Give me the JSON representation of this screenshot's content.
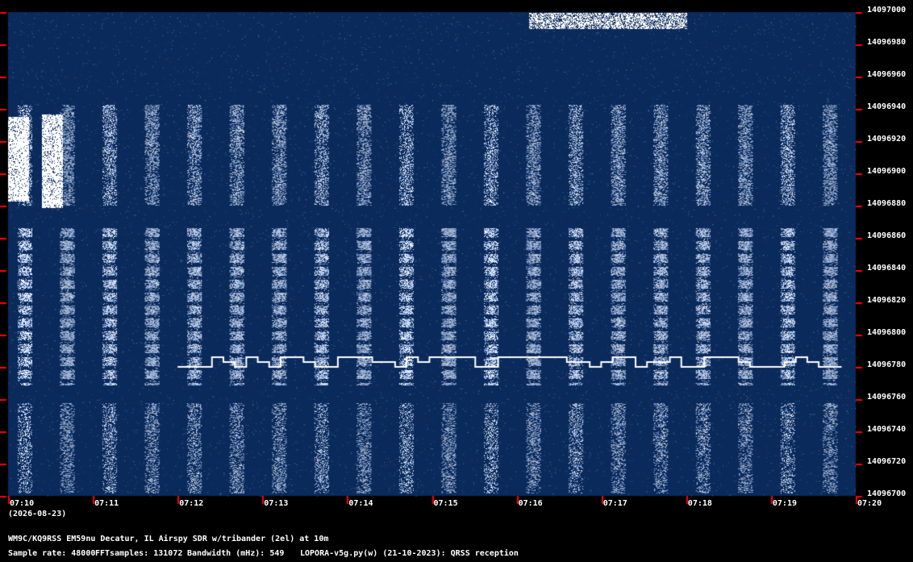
{
  "chart_data": {
    "type": "heatmap",
    "subtype": "spectrogram-waterfall",
    "y_ticks": [
      "14097000",
      "14096980",
      "14096960",
      "14096940",
      "14096920",
      "14096900",
      "14096880",
      "14096860",
      "14096840",
      "14096820",
      "14096800",
      "14096780",
      "14096760",
      "14096740",
      "14096720",
      "14096700"
    ],
    "ylim": [
      14096700,
      14097000
    ],
    "x_ticks": [
      "07:10",
      "07:11",
      "07:12",
      "07:13",
      "07:14",
      "07:15",
      "07:16",
      "07:17",
      "07:18",
      "07:19",
      "07:20"
    ],
    "x_date": "(2026-08-23)",
    "colors": {
      "background": "#0a2a5c",
      "signal": "#ffffff",
      "tick_marks": "#ff0000",
      "frame": "#000000"
    },
    "fsk_trace": {
      "base_hz": 14096780,
      "levels_hz": [
        14096780,
        14096783,
        14096786
      ],
      "start_time": "07:12",
      "end_time": "07:19:50",
      "sequence": [
        0,
        0,
        0,
        2,
        1,
        0,
        2,
        1,
        0,
        2,
        2,
        1,
        0,
        0,
        2,
        2,
        2,
        1,
        1,
        0,
        2,
        1,
        2,
        2,
        2,
        2,
        0,
        0,
        2,
        2,
        2,
        2,
        2,
        2,
        1,
        1,
        0,
        1,
        2,
        2,
        0,
        1,
        1,
        2,
        0,
        0,
        2,
        2,
        2,
        1,
        0,
        0,
        0,
        1,
        2,
        1,
        0,
        0
      ]
    }
  },
  "footer": {
    "station": "WM9C/KQ9RSS EM59nu Decatur, IL  Airspy SDR w/tribander (2el) at 10m",
    "sample_rate": "Sample rate: 48000",
    "fft_samples": "FFTsamples: 131072",
    "bandwidth": "Bandwidth (mHz): 549",
    "software": "LOPORA-v5g.py(w) (21-10-2023): QRSS reception"
  }
}
